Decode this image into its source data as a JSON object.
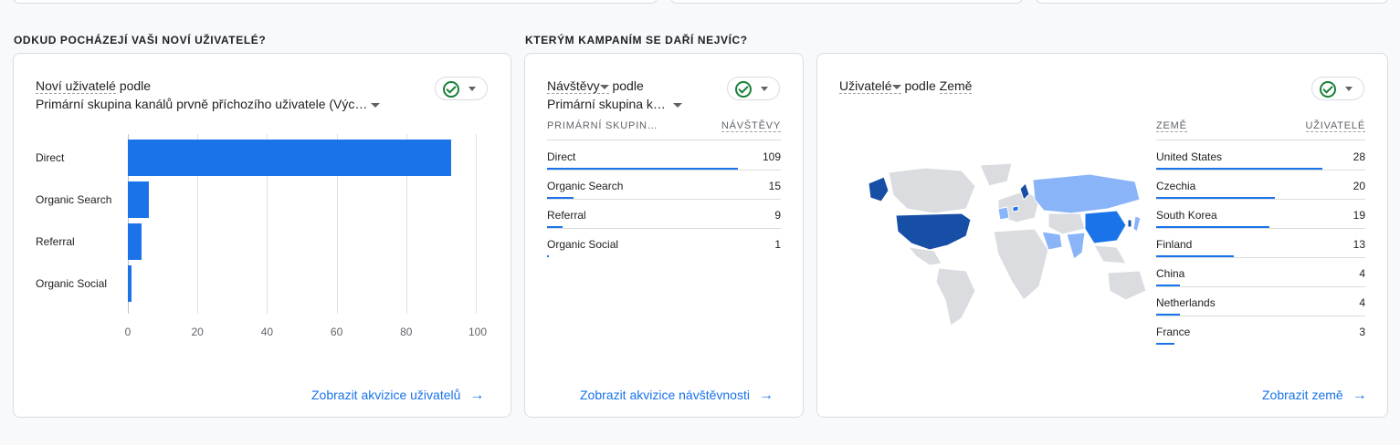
{
  "sections": {
    "left_title": "ODKUD POCHÁZEJÍ VAŠI NOVÍ UŽIVATELÉ?",
    "right_title": "KTERÝM KAMPANÍM SE DAŘÍ NEJVÍC?"
  },
  "card1": {
    "metric": "Noví uživatelé",
    "by": "podle",
    "dimension": "Primární skupina kanálů prvně příchozího uživatele (Výc…",
    "link": "Zobrazit akvizice uživatelů",
    "ticks": [
      "0",
      "20",
      "40",
      "60",
      "80",
      "100"
    ]
  },
  "card2": {
    "metric": "Návštěvy",
    "by": "podle",
    "dimension": "Primární skupina k…",
    "col1": "PRIMÁRNÍ SKUPIN…",
    "col2": "NÁVŠTĚVY",
    "rows": [
      {
        "label": "Direct",
        "value": "109"
      },
      {
        "label": "Organic Search",
        "value": "15"
      },
      {
        "label": "Referral",
        "value": "9"
      },
      {
        "label": "Organic Social",
        "value": "1"
      }
    ],
    "link": "Zobrazit akvizice návštěvnosti"
  },
  "card3": {
    "metric": "Uživatelé",
    "by": "podle",
    "dimension": "Země",
    "col1": "ZEMĚ",
    "col2": "UŽIVATELÉ",
    "rows": [
      {
        "label": "United States",
        "value": "28"
      },
      {
        "label": "Czechia",
        "value": "20"
      },
      {
        "label": "South Korea",
        "value": "19"
      },
      {
        "label": "Finland",
        "value": "13"
      },
      {
        "label": "China",
        "value": "4"
      },
      {
        "label": "Netherlands",
        "value": "4"
      },
      {
        "label": "France",
        "value": "3"
      }
    ],
    "link": "Zobrazit země"
  },
  "colors": {
    "accent": "#1a73e8",
    "dark_blue": "#174ea6",
    "light_blue": "#8ab4f8",
    "land": "#dadce0"
  },
  "chart_data": {
    "type": "bar",
    "orientation": "horizontal",
    "categories": [
      "Direct",
      "Organic Search",
      "Referral",
      "Organic Social"
    ],
    "values": [
      93,
      6,
      4,
      1
    ],
    "xlim": [
      0,
      100
    ],
    "grid": true
  }
}
